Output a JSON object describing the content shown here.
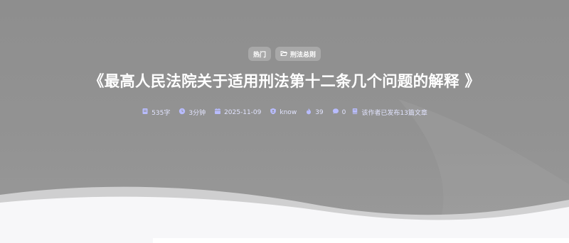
{
  "tags": [
    {
      "label": "热门",
      "icon": ""
    },
    {
      "label": "刑法总则",
      "icon": "folder-open-icon"
    }
  ],
  "title": "《最高人民法院关于适用刑法第十二条几个问题的解释 》",
  "meta": {
    "word_count": "535字",
    "read_time": "3分钟",
    "date": "2025-11-09",
    "author": "know",
    "views": "39",
    "comments": "0",
    "articles": "该作者已发布13篇文章"
  },
  "colors": {
    "hero_bg": "#8f8f8f",
    "meta_text": "#e2e4ff",
    "icon_accent": "#b8bcff",
    "wave": "#f5f5f7"
  }
}
